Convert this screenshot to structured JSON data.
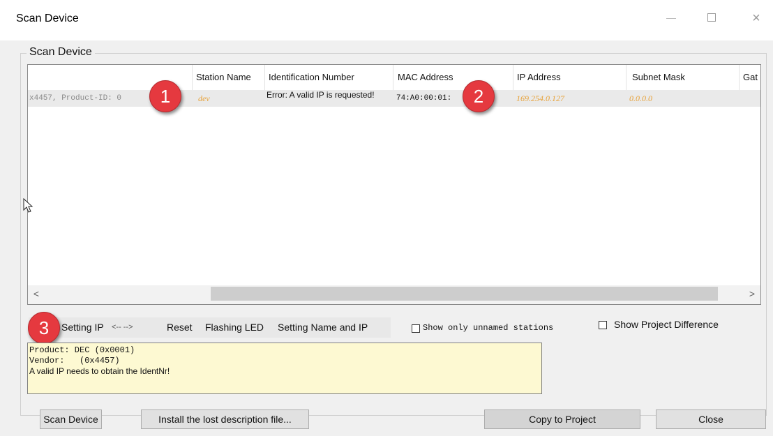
{
  "window": {
    "title": "Scan Device"
  },
  "group": {
    "label": "Scan Device"
  },
  "table": {
    "columns": [
      "Station Name",
      "Identification Number",
      "MAC Address",
      "IP Address",
      "Subnet Mask",
      "Gat"
    ],
    "row": {
      "first_cell": "x4457, Product-ID: 0",
      "station_name": "dev",
      "identification": "Error: A valid IP is requested!",
      "mac": "74:A0:00:01:",
      "ip": "169.254.0.127",
      "subnet": "0.0.0.0"
    },
    "scroll_left": "<",
    "scroll_right": ">"
  },
  "badges": [
    "1",
    "2",
    "3"
  ],
  "actions": {
    "setting_ip": "Setting IP",
    "arrows": "<--  -->",
    "reset": "Reset",
    "flashing_led": "Flashing LED",
    "setting_name": "Setting Name and IP"
  },
  "options": {
    "unnamed": "Show only unnamed stations",
    "project_diff": "Show Project Difference"
  },
  "info": {
    "line1": "Product: DEC (0x0001)",
    "line2": "Vendor:   (0x4457)",
    "line3": "A valid IP needs to obtain the IdentNr!"
  },
  "buttons": {
    "scan": "Scan Device",
    "install": "Install the lost description file...",
    "copy": "Copy to Project",
    "close": "Close"
  },
  "colors": {
    "badge": "#e5393f",
    "warning_text": "#e7a33c",
    "info_bg": "#fdf9d2"
  }
}
